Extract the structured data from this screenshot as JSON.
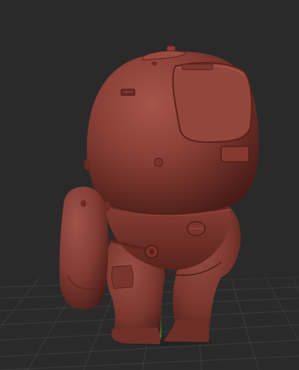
{
  "viewport": {
    "background_color": "#2a2a2a",
    "grid_color": "#3c3c3c",
    "model_color": "#8a3f36",
    "model_highlight": "#a85a50",
    "model_shadow": "#4e1e18",
    "y_axis_color": "#38c23a",
    "x_axis_color": "#c23a2a"
  },
  "model": {
    "icon": "sculpt-character-model"
  }
}
